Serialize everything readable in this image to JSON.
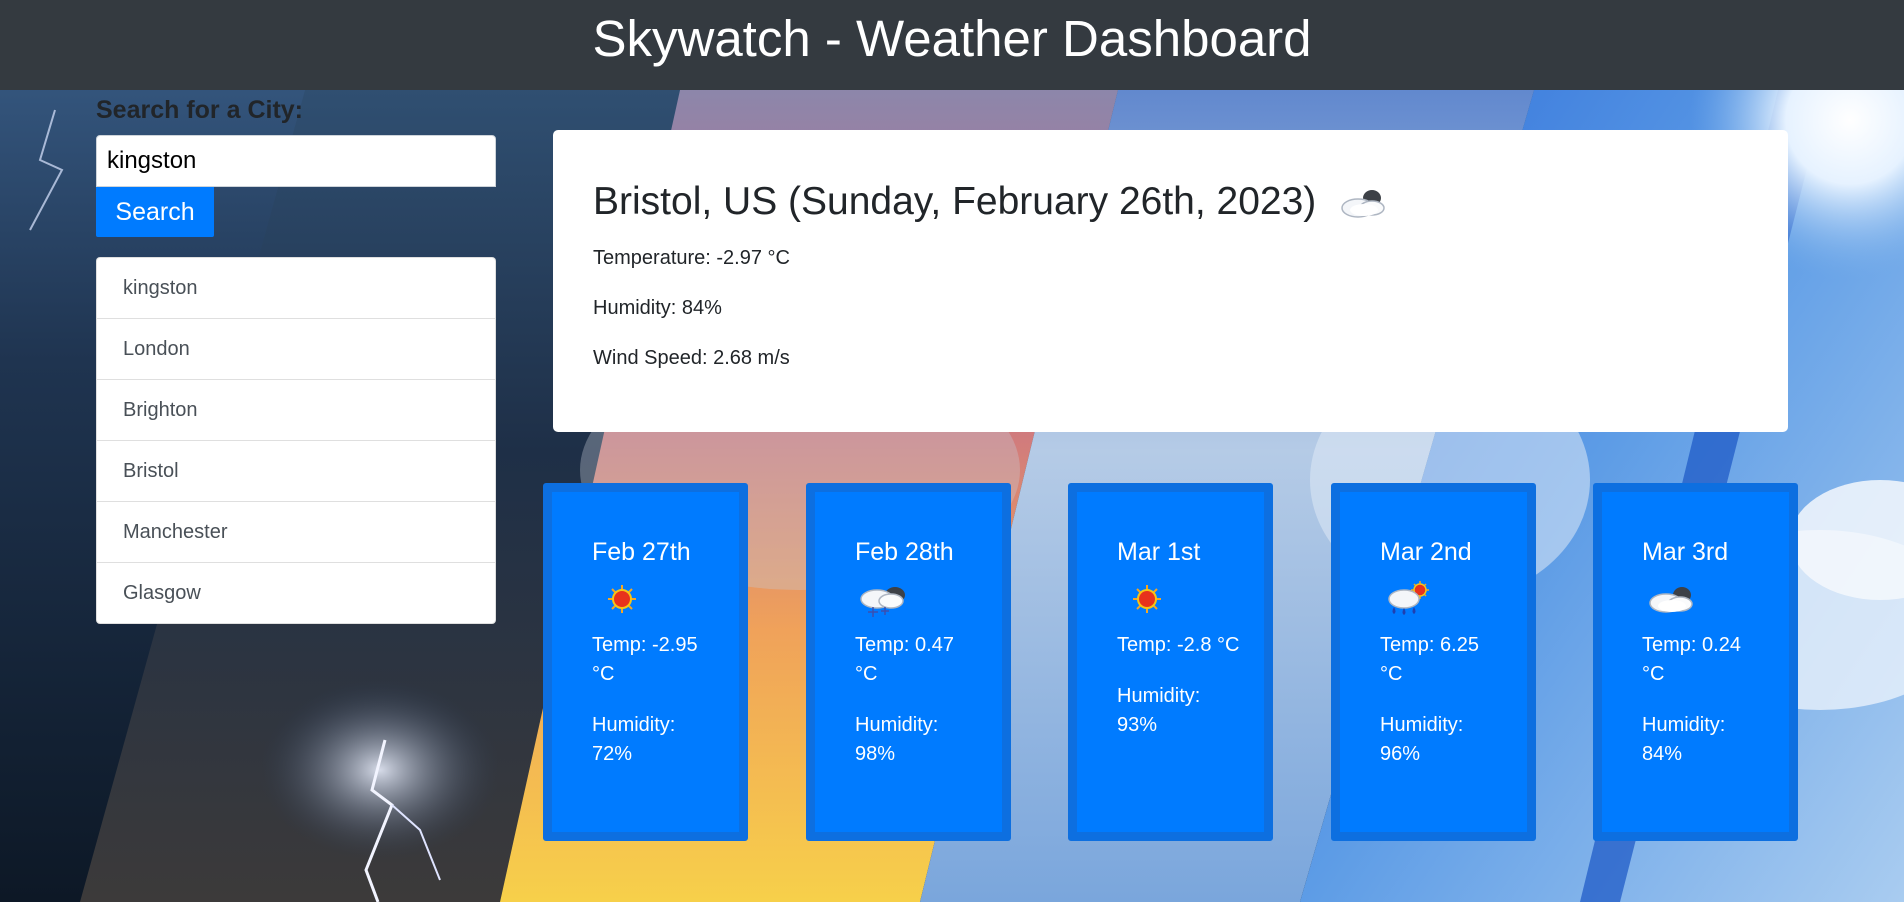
{
  "header": {
    "title": "Skywatch - Weather Dashboard"
  },
  "search": {
    "label": "Search for a City:",
    "input_value": "kingston",
    "button_label": "Search"
  },
  "history": {
    "items": [
      {
        "label": "kingston"
      },
      {
        "label": "London"
      },
      {
        "label": "Brighton"
      },
      {
        "label": "Bristol"
      },
      {
        "label": "Manchester"
      },
      {
        "label": "Glasgow"
      }
    ]
  },
  "current": {
    "title": "Bristol, US (Sunday, February 26th, 2023)",
    "icon": "cloud-sun-icon",
    "temperature": "Temperature: -2.97 °C",
    "humidity": "Humidity: 84%",
    "wind": "Wind Speed: 2.68 m/s"
  },
  "forecast": [
    {
      "date": "Feb 27th",
      "icon": "sun-icon",
      "temp": "Temp: -2.95 °C",
      "humidity": "Humidity: 72%"
    },
    {
      "date": "Feb 28th",
      "icon": "snow-cloud-icon",
      "temp": "Temp: 0.47 °C",
      "humidity": "Humidity: 98%"
    },
    {
      "date": "Mar 1st",
      "icon": "sun-icon",
      "temp": "Temp: -2.8 °C",
      "humidity": "Humidity: 93%"
    },
    {
      "date": "Mar 2nd",
      "icon": "rain-sun-icon",
      "temp": "Temp: 6.25 °C",
      "humidity": "Humidity: 96%"
    },
    {
      "date": "Mar 3rd",
      "icon": "cloud-sun-icon",
      "temp": "Temp: 0.24 °C",
      "humidity": "Humidity: 84%"
    }
  ],
  "colors": {
    "header_bg": "#343a40",
    "accent": "#007bff",
    "card_border": "#0d6fe0"
  }
}
